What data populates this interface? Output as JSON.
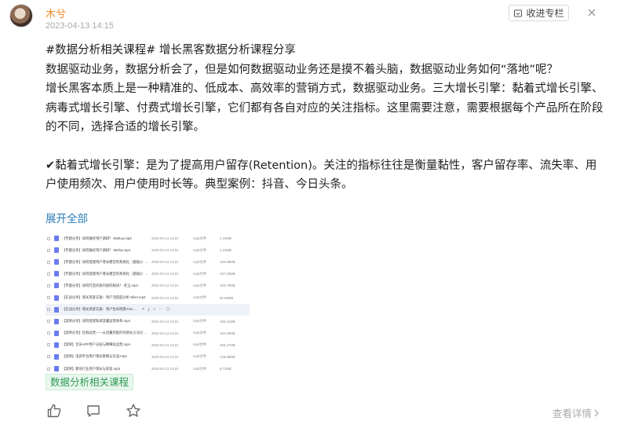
{
  "author": {
    "name": "木兮",
    "date": "2023-04-13 14:15"
  },
  "header": {
    "collect_label": "收进专栏"
  },
  "post": {
    "line1": "#数据分析相关课程# 增长黑客数据分析课程分享",
    "line2": "数据驱动业务，数据分析会了，但是如何数据驱动业务还是摸不着头脑，数据驱动业务如何“落地”呢？",
    "line3": "增长黑客本质上是一种精准的、低成本、高效率的营销方式，数据驱动业务。三大增长引擎：黏着式增长引擎、病毒式增长引擎、付费式增长引擎，它们都有各自对应的关注指标。这里需要注意，需要根据每个产品所在阶段的不同，选择合适的增长引擎。",
    "line4": "✔黏着式增长引擎：是为了提高用户留存(Retention)。关注的指标往往是衡量黏性，客户留存率、流失率、用户使用频次、用户使用时长等。典型案例：抖音、今日头条。"
  },
  "expand_label": "展开全部",
  "files": [
    {
      "name": "【专题分享】如何做好用户调研？-Mahua.mp3",
      "time": "2023-04-13 14:15",
      "type": "mp3文件",
      "size": "2.24MB"
    },
    {
      "name": "【专题分享】如何做好用户调研？-Misha.mp3",
      "time": "2023-04-13 14:15",
      "type": "mp3文件",
      "size": "2.24MB"
    },
    {
      "name": "【专题分享】如何搭建用户增长模型的系统化（基础1）.mp4",
      "time": "2023-04-13 14:15",
      "type": "mp4文件",
      "size": "136.89MB"
    },
    {
      "name": "【专题分享】如何搭建用户增长模型的系统化（基础2）.mp4",
      "time": "2023-04-13 14:15",
      "type": "mp4文件",
      "size": "107.23MB"
    },
    {
      "name": "【专题分享】如何打造优质内容的秘诀？-老王.mp4",
      "time": "2023-04-13 14:15",
      "type": "mp4文件",
      "size": "153.78MB"
    },
    {
      "name": "【实战分享】增长黑客实操：用户活跃度分析-Ellen.mp4",
      "time": "2023-04-13 14:15",
      "type": "mp4文件",
      "size": "86.89MB"
    },
    {
      "name": "【实战分享】增长黑客实操：用户生命周期-Kim.mp4",
      "time": "",
      "type": "",
      "size": ""
    },
    {
      "name": "【案例分享】如何搭建私域流量运营体系.mp4",
      "time": "2023-04-13 14:15",
      "type": "mp4文件",
      "size": "189.21MB"
    },
    {
      "name": "【案例分享】社群运营——从流量到留存的增长方法论.mp4",
      "time": "2023-04-13 14:15",
      "type": "mp4文件",
      "size": "162.59MB"
    },
    {
      "name": "【案例】音乐APP用户分层与精细化运营.mp4",
      "time": "2023-04-13 14:15",
      "type": "mp4文件",
      "size": "268.27MB"
    },
    {
      "name": "【案例】电商平台用户增长策略与实战.mp4",
      "time": "2023-04-13 14:15",
      "type": "mp4文件",
      "size": "128.89MB"
    },
    {
      "name": "【案例】教培行业用户增长与获客.mp3",
      "time": "2023-04-13 14:15",
      "type": "mp3文件",
      "size": "8.72MB"
    }
  ],
  "topic_tag": "数据分析相关课程",
  "footer": {
    "details_label": "查看详情"
  },
  "colors": {
    "author": "#f08a24",
    "link": "#2a7bb5",
    "tag_text": "#2e9a55",
    "tag_bg": "#e9f7ee"
  }
}
